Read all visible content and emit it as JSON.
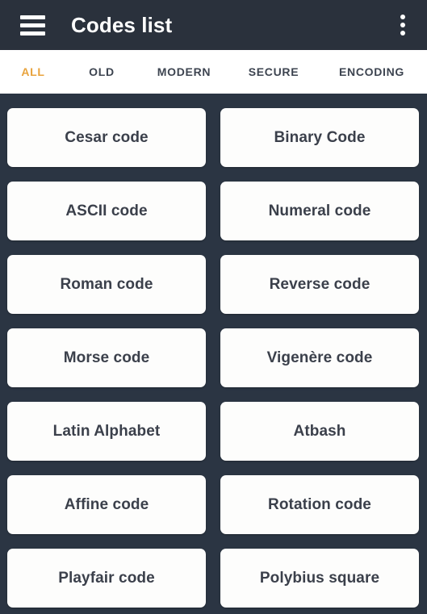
{
  "app": {
    "title": "Codes list",
    "background_color": "#2b3543",
    "appbar_color": "#2a313c",
    "accent_color": "#e8a33d",
    "card_color": "#fdfdfc",
    "card_text_color": "#3b404b"
  },
  "appbar": {
    "menu_icon": "hamburger-menu-icon",
    "title": "Codes list",
    "overflow_icon": "more-vertical-icon"
  },
  "tabs": {
    "active_index": 0,
    "items": [
      {
        "label": "ALL",
        "active": true
      },
      {
        "label": "OLD",
        "active": false
      },
      {
        "label": "MODERN",
        "active": false
      },
      {
        "label": "SECURE",
        "active": false
      },
      {
        "label": "ENCODING",
        "active": false
      }
    ]
  },
  "grid": {
    "columns": 2,
    "cards": [
      {
        "label": "Cesar code"
      },
      {
        "label": "Binary Code"
      },
      {
        "label": "ASCII code"
      },
      {
        "label": "Numeral code"
      },
      {
        "label": "Roman code"
      },
      {
        "label": "Reverse code"
      },
      {
        "label": "Morse code"
      },
      {
        "label": "Vigenère code"
      },
      {
        "label": "Latin Alphabet"
      },
      {
        "label": "Atbash"
      },
      {
        "label": "Affine code"
      },
      {
        "label": "Rotation code"
      },
      {
        "label": "Playfair code"
      },
      {
        "label": "Polybius square"
      }
    ]
  }
}
